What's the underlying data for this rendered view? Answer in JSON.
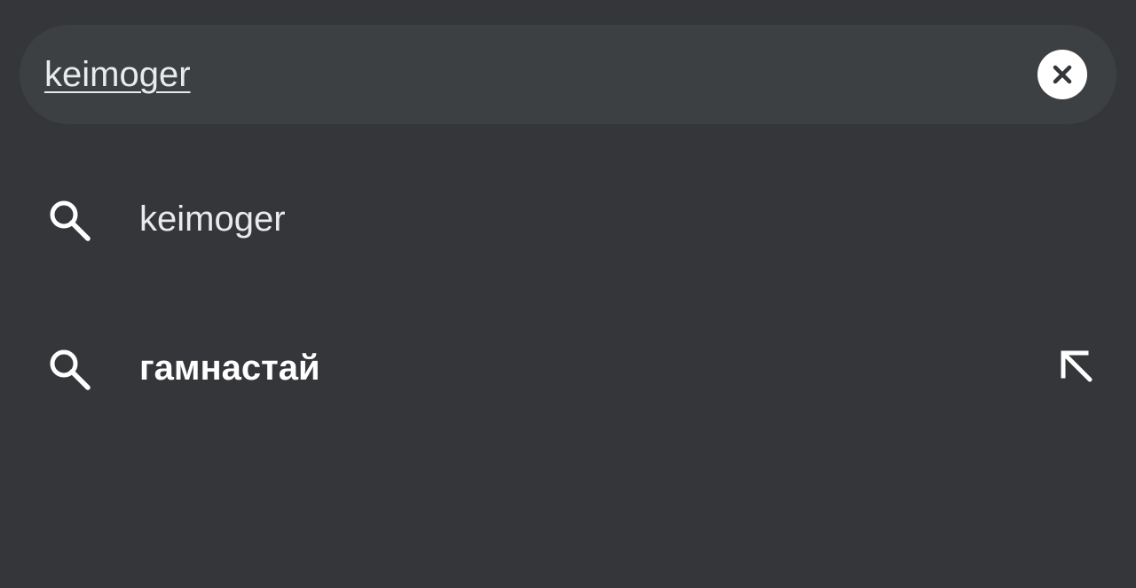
{
  "search": {
    "query": "keimoger",
    "clear_icon": "close-circle-icon"
  },
  "suggestions": [
    {
      "text": "keimoger",
      "icon": "search-icon",
      "bold": false,
      "has_fill_arrow": false
    },
    {
      "text": "гамнастай",
      "icon": "search-icon",
      "bold": true,
      "has_fill_arrow": true,
      "fill_icon": "arrow-up-left-icon"
    }
  ],
  "colors": {
    "background": "#35363a",
    "search_bar": "#3c4043",
    "text": "#e8eaed",
    "icon": "#ffffff"
  }
}
